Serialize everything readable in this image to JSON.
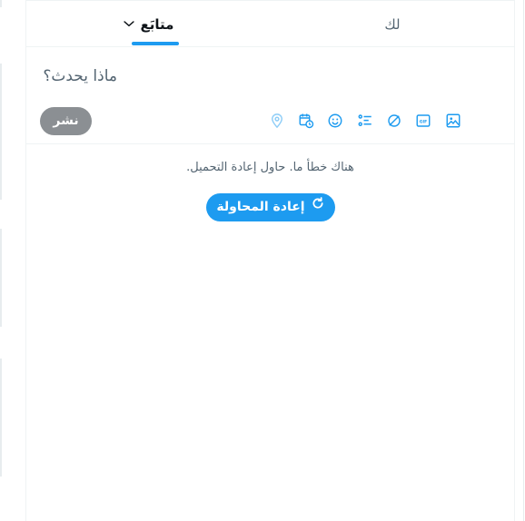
{
  "tabs": {
    "following_label": "متابَع",
    "foryou_label": "لك"
  },
  "composer": {
    "placeholder": "ماذا يحدث؟",
    "post_label": "نشر",
    "tools": [
      "image-icon",
      "gif-icon",
      "grok-icon",
      "poll-icon",
      "emoji-icon",
      "schedule-icon",
      "location-icon"
    ]
  },
  "feed": {
    "error_message": "هناك خطأ ما. حاول إعادة التحميل.",
    "retry_label": "إعادة المحاولة"
  },
  "colors": {
    "accent": "#1d9bf0",
    "post_disabled": "#8b8f93",
    "secondary_text": "#536471",
    "border": "#eff3f4"
  }
}
